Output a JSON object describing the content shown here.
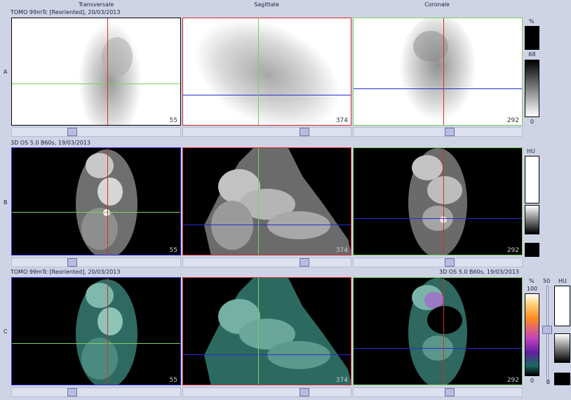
{
  "headers": {
    "transversale": "Transversale",
    "sagittale": "Sagittale",
    "coronale": "Coronale"
  },
  "rows": {
    "a": {
      "label": "A",
      "title": "TOMO 99mTc [Reoriented], 20/03/2013"
    },
    "b": {
      "label": "B",
      "title": "3D  OS  5.0  B60s, 19/03/2013"
    },
    "c": {
      "label": "C",
      "title_left": "TOMO 99mTc [Reoriented], 20/03/2013",
      "title_right": "3D  OS  5.0  B60s, 19/03/2013"
    }
  },
  "slices": {
    "transversale": "55",
    "sagittale": "374",
    "coronale": "292"
  },
  "scales": {
    "a": {
      "unit": "%",
      "max": "68",
      "min": "0"
    },
    "b": {
      "unit": "HU"
    },
    "c": {
      "unit_nm": "%",
      "max": "100",
      "min": "0",
      "mid": "50",
      "unit_ct": "HU",
      "ct_min": "0"
    }
  },
  "colors": {
    "transversale": "#2b2bd8",
    "sagittale": "#d42c2c",
    "coronale": "#7ad05a",
    "crosshair_green": "#7ad05a",
    "crosshair_red": "#d42c2c",
    "crosshair_blue": "#2b2bd8"
  }
}
